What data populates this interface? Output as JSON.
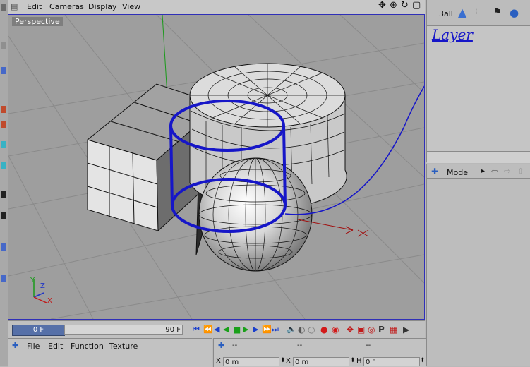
{
  "viewport": {
    "menu": [
      "Edit",
      "Cameras",
      "Display",
      "View"
    ],
    "view_name": "Perspective",
    "axis_labels": {
      "y": "Y",
      "z": "Z",
      "x": "X"
    }
  },
  "object_manager": {
    "object_name": "3all"
  },
  "annotation": {
    "text": "Layer"
  },
  "attributes": {
    "mode_label": "Mode"
  },
  "timeline": {
    "current_frame": "0 F",
    "end_frame": "90 F"
  },
  "material_manager": {
    "menu": [
      "File",
      "Edit",
      "Function",
      "Texture"
    ]
  },
  "coordinates": {
    "header_cols": [
      "--",
      "--",
      "--"
    ],
    "fields": [
      {
        "label": "X",
        "value": "0 m"
      },
      {
        "label": "X",
        "value": "0 m"
      },
      {
        "label": "H",
        "value": "0 °"
      }
    ]
  },
  "colors": {
    "annotation_blue": "#1616c8",
    "playback_green": "#1aa01a",
    "playback_blue": "#1a3fcc",
    "record_red": "#d21a1a"
  }
}
